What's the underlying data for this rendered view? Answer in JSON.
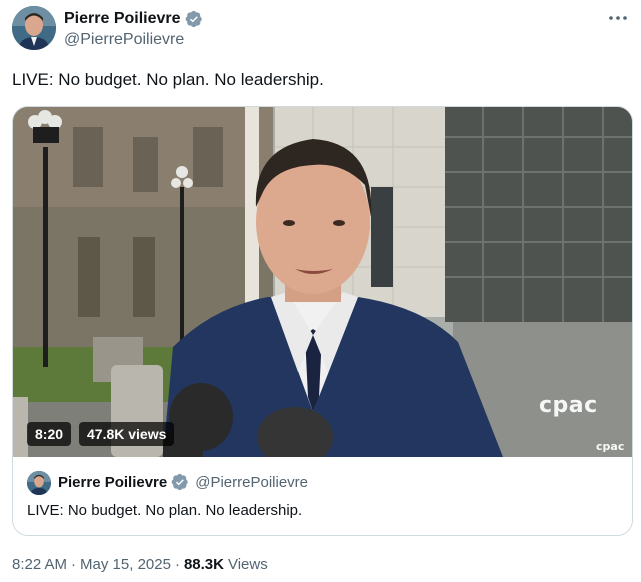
{
  "author": {
    "display_name": "Pierre Poilievre",
    "handle": "@PierrePoilievre"
  },
  "tweet": {
    "text": "LIVE: No budget. No plan. No leadership."
  },
  "video": {
    "duration": "8:20",
    "views": "47.8K views",
    "watermark": "cpac",
    "watermark_small": "cpac"
  },
  "quote": {
    "display_name": "Pierre Poilievre",
    "handle": "@PierrePoilievre",
    "text": "LIVE: No budget. No plan. No leadership."
  },
  "meta": {
    "time": "8:22 AM",
    "sep1": "·",
    "date": "May 15, 2025",
    "sep2": "·",
    "view_count": "88.3K",
    "views_label": "Views"
  },
  "colors": {
    "verified_badge": "#829aab",
    "secondary_text": "#536471",
    "primary_text": "#0f1419",
    "border": "#cfd9de"
  },
  "icons": {
    "verified": "verified-badge-icon",
    "more": "more-dots-icon"
  }
}
